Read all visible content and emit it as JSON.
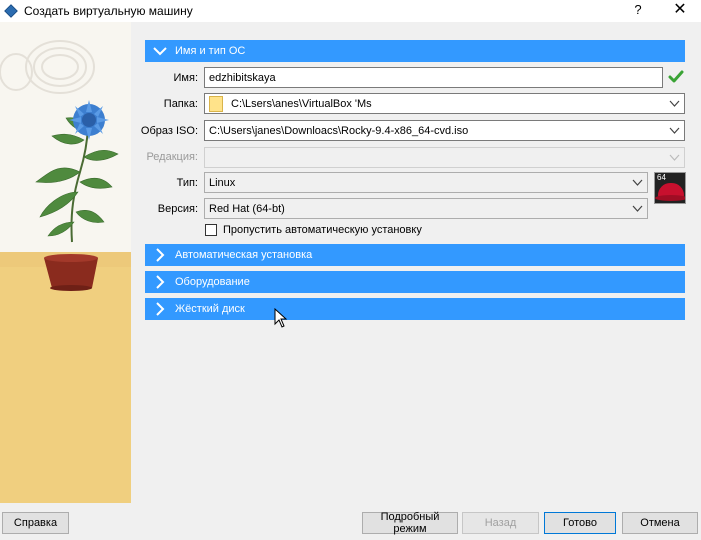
{
  "window": {
    "title": "Создать виртуальную машину",
    "help_label": "?",
    "close_label": "✕"
  },
  "sections": {
    "name_os": {
      "label": "Имя и тип ОС",
      "expanded": true
    },
    "unattended": {
      "label": "Автоматическая установка",
      "expanded": false
    },
    "hardware": {
      "label": "Оборудование",
      "expanded": false
    },
    "harddisk": {
      "label": "Жёсткий диск",
      "expanded": false
    }
  },
  "form": {
    "name": {
      "label": "Имя:",
      "value": "edzhibitskaya",
      "valid": true
    },
    "folder": {
      "label": "Папка:",
      "value": "C:\\Lsers\\anes\\VirtualBox 'Ms"
    },
    "iso": {
      "label": "Образ ISO:",
      "value": "C:\\Users\\janes\\Downloacs\\Rocky-9.4-x86_64-cvd.iso"
    },
    "edition": {
      "label": "Редакция:",
      "value": "",
      "disabled": true
    },
    "type": {
      "label": "Тип:",
      "value": "Linux"
    },
    "version": {
      "label": "Версия:",
      "value": "Red Hat (64-bt)"
    },
    "os_badge": "64",
    "skip_unattended": {
      "label": "Пропустить автоматическую установку",
      "checked": false
    }
  },
  "buttons": {
    "help": "Справка",
    "expert": "Подробный режим",
    "back": "Назад",
    "finish": "Готово",
    "cancel": "Отмена"
  },
  "colors": {
    "section_header": "#3399ff",
    "ok_check": "#3aa335"
  }
}
